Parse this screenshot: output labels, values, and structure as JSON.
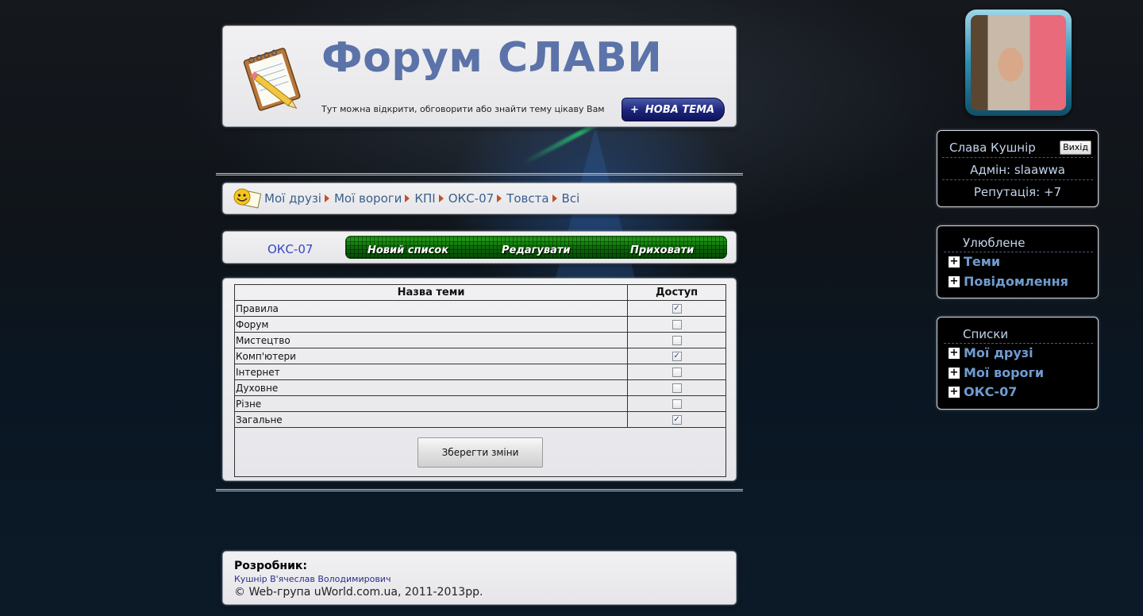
{
  "header": {
    "title": "Форум СЛАВИ",
    "tagline": "Тут можна відкрити, обговорити або знайти тему цікаву Вам",
    "new_topic_label": "НОВА ТЕМА",
    "new_topic_plus": "+"
  },
  "breadcrumb": {
    "items": [
      "Мої друзі",
      "Мої вороги",
      "КПІ",
      "ОКС-07",
      "Товста",
      "Всі"
    ]
  },
  "toolbar": {
    "list_name": "ОКС-07",
    "new_list": "Новий список",
    "edit": "Редагувати",
    "hide": "Приховати"
  },
  "table": {
    "col_name": "Назва теми",
    "col_access": "Доступ",
    "rows": [
      {
        "name": "Правила",
        "checked": true
      },
      {
        "name": "Форум",
        "checked": false
      },
      {
        "name": "Мистецтво",
        "checked": false
      },
      {
        "name": "Комп'ютери",
        "checked": true
      },
      {
        "name": "Інтернет",
        "checked": false
      },
      {
        "name": "Духовне",
        "checked": false
      },
      {
        "name": "Різне",
        "checked": false
      },
      {
        "name": "Загальне",
        "checked": true
      }
    ],
    "save_label": "Зберегти зміни"
  },
  "footer": {
    "dev_title": "Розробник:",
    "dev_name": "Кушнір В'ячеслав Володимирович",
    "copyright": "© Web-група uWorld.com.ua, 2011-2013рр."
  },
  "user": {
    "name": "Слава Кушнір",
    "logout": "Вихід",
    "admin": "Адмін: slaawwa",
    "reputation": "Репутація: +7"
  },
  "favorites": {
    "title": "Улюблене",
    "items": [
      "Теми",
      "Повідомлення"
    ]
  },
  "lists": {
    "title": "Списки",
    "items": [
      "Мої друзі",
      "Мої вороги",
      "ОКС-07"
    ]
  },
  "colors": {
    "title_blue": "#5b73a8",
    "link_blue": "#3b5f8a",
    "green_bar": "#0d6b0a",
    "side_link": "#6f9cd0"
  }
}
